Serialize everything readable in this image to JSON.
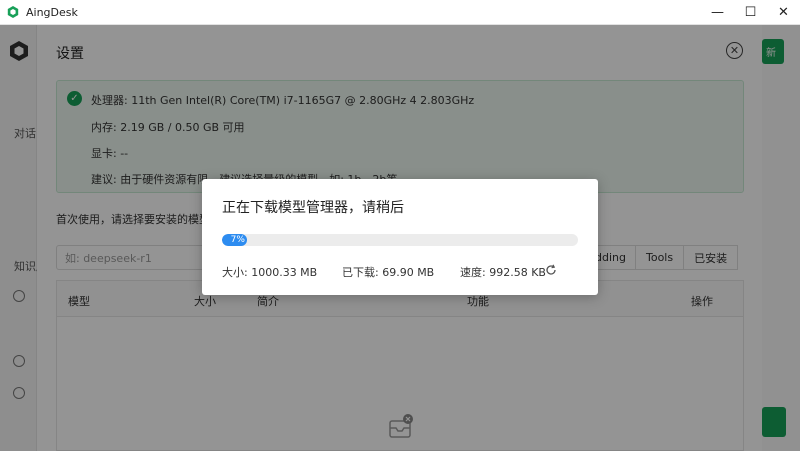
{
  "window": {
    "title": "AingDesk",
    "controls": {
      "minimize": "—",
      "maximize": "☐",
      "close": "✕"
    }
  },
  "sidebar": {
    "chat_label": "对话",
    "knowledge_label": "知识库"
  },
  "background": {
    "top_button_label": "新"
  },
  "settings": {
    "title": "设置",
    "close_icon": "close-circle-icon",
    "system_info": {
      "cpu": "处理器: 11th Gen Intel(R) Core(TM) i7-1165G7 @ 2.80GHz 4 2.803GHz",
      "memory": "内存: 2.19 GB / 0.50 GB 可用",
      "gpu": "显卡: --",
      "suggestion": "建议: 由于硬件资源有限，建议选择量级的模型，如: 1b、2b等"
    },
    "first_use_text": "首次使用，请选择要安装的模型",
    "search": {
      "placeholder": "如: deepseek-r1"
    },
    "tabs": [
      {
        "label": "Embedding"
      },
      {
        "label": "Tools"
      },
      {
        "label": "已安装"
      }
    ],
    "table": {
      "headers": [
        "模型",
        "大小",
        "简介",
        "功能",
        "操作"
      ]
    }
  },
  "download_modal": {
    "title": "正在下载模型管理器，请稍后",
    "progress_percent": 7,
    "progress_label": "7%",
    "total_size": "大小: 1000.33 MB",
    "downloaded": "已下载: 69.90 MB",
    "speed": "速度: 992.58 KB"
  },
  "colors": {
    "accent_green": "#18a058",
    "progress_blue": "#2d8cf0",
    "info_bg": "#edf7f0"
  }
}
